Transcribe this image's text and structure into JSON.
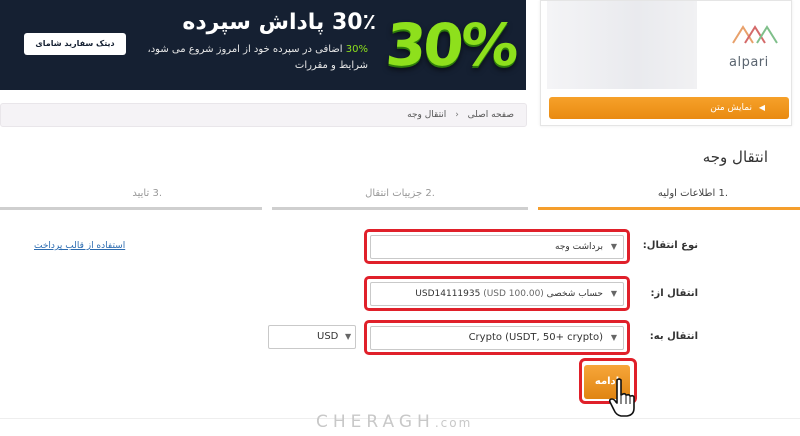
{
  "banner": {
    "percent": "30%",
    "headline": "30٪ پاداش سپرده",
    "sub_pct": "30%",
    "sub_line1": "اضافی در سپرده خود از امروز شروع می شود،",
    "sub_line2": "شرایط و مقررات",
    "cta_label": "دیتک سفارید شامای"
  },
  "brand": {
    "logo_name": "alpari",
    "demo_button": "نمایش متن"
  },
  "breadcrumb": {
    "home": "صفحه اصلی",
    "current": "انتقال وجه"
  },
  "page_title": "انتقال وجه",
  "steps": [
    {
      "label": ".1 اطلاعات اولیه"
    },
    {
      "label": ".2 جزییات انتقال"
    },
    {
      "label": ".3 تایید"
    }
  ],
  "form": {
    "transfer_type_label": "نوع انتقال:",
    "transfer_type_value": "برداشت وجه",
    "template_link": "استفاده از قالب پرداخت",
    "from_label": "انتقال از:",
    "from_value": "حساب شخصی USD14111935",
    "from_balance": "(USD 100.00)",
    "to_label": "انتقال به:",
    "to_value": "Crypto (USDT, 50+ crypto)",
    "currency_value": "USD",
    "next_button": "ادامه"
  },
  "watermark": {
    "main": "CHERAGH",
    "suffix": ".com"
  },
  "colors": {
    "accent_orange": "#f59e2c",
    "highlight_red": "#e0202a",
    "banner_bg": "#152032",
    "banner_green": "#8ee01c"
  }
}
